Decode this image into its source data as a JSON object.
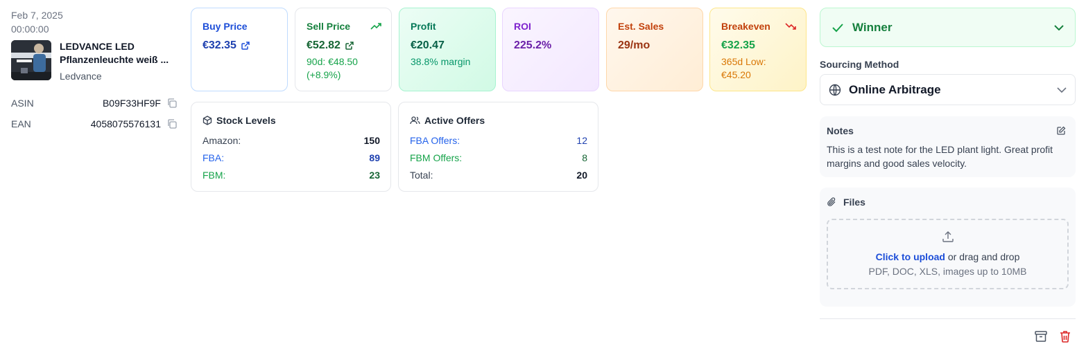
{
  "product": {
    "date": "Feb 7, 2025",
    "time": "00:00:00",
    "title_line1": "LEDVANCE LED",
    "title_line2": "Pflanzenleuchte weiß ...",
    "brand": "Ledvance",
    "asin_label": "ASIN",
    "asin": "B09F33HF9F",
    "ean_label": "EAN",
    "ean": "4058075576131"
  },
  "metrics": {
    "buy": {
      "title": "Buy Price",
      "value": "€32.35"
    },
    "sell": {
      "title": "Sell Price",
      "value": "€52.82",
      "sub1": "90d: €48.50",
      "sub2": "(+8.9%)"
    },
    "profit": {
      "title": "Profit",
      "value": "€20.47",
      "sub": "38.8% margin"
    },
    "roi": {
      "title": "ROI",
      "value": "225.2%"
    },
    "sales": {
      "title": "Est. Sales",
      "value": "29/mo"
    },
    "breakeven": {
      "title": "Breakeven",
      "value": "€32.35",
      "sub1": "365d Low:",
      "sub2": "€45.20"
    }
  },
  "stock": {
    "title": "Stock Levels",
    "rows": [
      {
        "label": "Amazon:",
        "value": "150"
      },
      {
        "label": "FBA:",
        "value": "89"
      },
      {
        "label": "FBM:",
        "value": "23"
      }
    ]
  },
  "offers": {
    "title": "Active Offers",
    "rows": [
      {
        "label": "FBA Offers:",
        "value": "12"
      },
      {
        "label": "FBM Offers:",
        "value": "8"
      },
      {
        "label": "Total:",
        "value": "20"
      }
    ]
  },
  "status": {
    "label": "Winner"
  },
  "sourcing": {
    "label": "Sourcing Method",
    "value": "Online Arbitrage"
  },
  "notes": {
    "title": "Notes",
    "body": "This is a test note for the LED plant light. Great profit margins and good sales velocity."
  },
  "files": {
    "title": "Files",
    "upload_link": "Click to upload",
    "upload_rest": " or drag and drop",
    "hint": "PDF, DOC, XLS, images up to 10MB"
  },
  "colors": {
    "blue": "#1d4ed8",
    "green": "#15803d",
    "purple": "#7e22ce",
    "orange": "#c2410c",
    "red": "#dc2626"
  }
}
